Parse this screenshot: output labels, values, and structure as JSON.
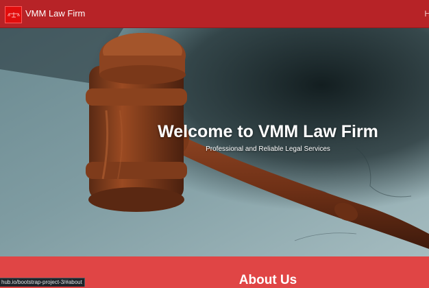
{
  "navbar": {
    "brand_name": "VMM Law Firm",
    "logo_icon": "scales-logo-icon",
    "nav_link_partial": "H",
    "background_color": "#b72327"
  },
  "hero": {
    "title": "Welcome to VMM Law Firm",
    "subtitle": "Professional and Reliable Legal Services",
    "image_subject": "judge-gavel-on-marble"
  },
  "about": {
    "heading": "About Us",
    "background_color": "#e04545"
  },
  "status_bar": {
    "url": "hub.io/bootstrap-project-3/#about"
  }
}
